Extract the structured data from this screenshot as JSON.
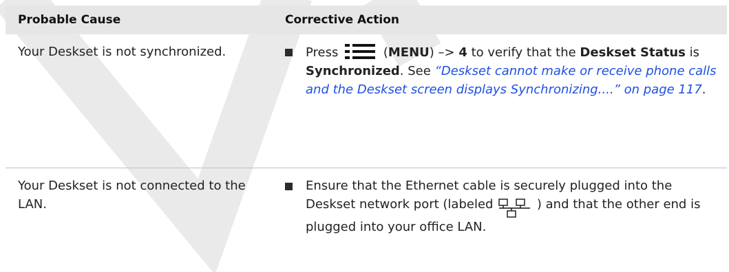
{
  "header": {
    "probable_cause": "Probable Cause",
    "corrective_action": "Corrective Action"
  },
  "rows": [
    {
      "cause": "Your Deskset is not synchronized.",
      "action": {
        "t1": "Press ",
        "t2": " (",
        "menu": "MENU",
        "t3": ") –> ",
        "key": "4",
        "t4": " to verify that the ",
        "status_label": "Deskset Status",
        "t5": " is ",
        "status_value": "Synchronized",
        "t6": ". See ",
        "link": "“Deskset cannot make or receive phone calls and the Deskset screen displays Synchronizing....” on page 117",
        "t7": "."
      }
    },
    {
      "cause": "Your Deskset is not connected to the LAN.",
      "action": {
        "t1": "Ensure that the Ethernet cable is securely plugged into the Deskset network port (labeled ",
        "t2": " ) and that the other end is plugged into your office LAN."
      }
    }
  ],
  "icons": {
    "menu": "menu-icon",
    "network": "network-port-icon"
  },
  "colors": {
    "header_bg": "#e6e6e6",
    "link": "#1f4fe0",
    "row_divider": "#b8bfd6"
  }
}
